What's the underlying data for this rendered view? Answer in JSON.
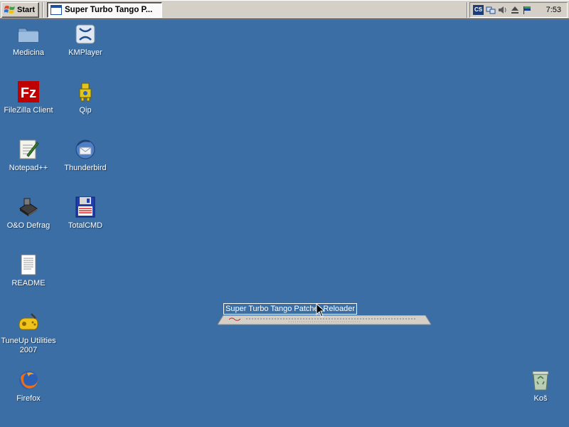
{
  "taskbar": {
    "start_label": "Start",
    "task_title": "Super Turbo Tango P...",
    "tray": {
      "icons": [
        "cs-icon",
        "network-icon",
        "volume-icon",
        "eject-icon",
        "flag-icon"
      ],
      "cs_label": "CS",
      "clock": "7:53"
    }
  },
  "desktop": {
    "icons": [
      {
        "name": "folder-icon",
        "label": "Medicina"
      },
      {
        "name": "kmplayer-icon",
        "label": "KMPlayer"
      },
      {
        "name": "filezilla-icon",
        "label": "FileZilla Client"
      },
      {
        "name": "qip-icon",
        "label": "Qip"
      },
      {
        "name": "notepad-icon",
        "label": "Notepad++"
      },
      {
        "name": "thunderbird-icon",
        "label": "Thunderbird"
      },
      {
        "name": "defrag-icon",
        "label": "O&O Defrag"
      },
      {
        "name": "totalcmd-icon",
        "label": "TotalCMD"
      },
      {
        "name": "document-icon",
        "label": "README"
      },
      {
        "name": "tuneup-icon",
        "label": "TuneUp Utilities 2007"
      },
      {
        "name": "firefox-icon",
        "label": "Firefox"
      },
      {
        "name": "recycle-bin-icon",
        "label": "Koš"
      }
    ]
  },
  "drag": {
    "caption": "Super Turbo Tango Patcher Reloader"
  },
  "colors": {
    "desktop": "#3a6ea5",
    "taskbar": "#d4d0c8"
  }
}
